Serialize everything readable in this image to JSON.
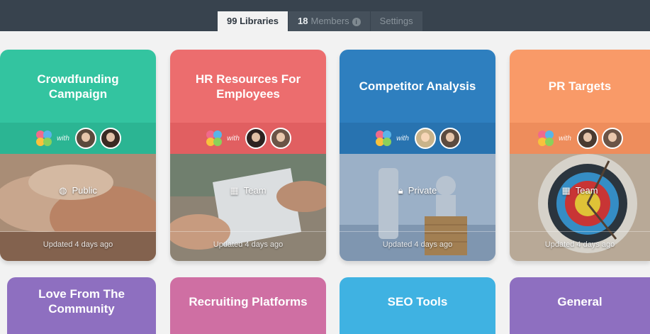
{
  "tabs": {
    "libraries_count": "99",
    "libraries_label": "Libraries",
    "members_count": "18",
    "members_label": "Members",
    "members_info_icon": "i",
    "settings_label": "Settings"
  },
  "colors": {
    "topbar": "#38434e",
    "green": "#33c4a0",
    "red": "#ec6d6e",
    "blue": "#2e7fbf",
    "orange": "#f99a68",
    "purple": "#8e6fc0",
    "pink": "#cf6fa3",
    "sky": "#3fb2e2"
  },
  "cards": [
    {
      "title": "Crowdfunding Campaign",
      "with": "with",
      "privacy_icon": "globe-icon",
      "privacy": "Public",
      "updated": "Updated 4 days ago"
    },
    {
      "title": "HR Resources For Employees",
      "with": "with",
      "privacy_icon": "building-icon",
      "privacy": "Team",
      "updated": "Updated 4 days ago"
    },
    {
      "title": "Competitor Analysis",
      "with": "with",
      "privacy_icon": "lock-icon",
      "privacy": "Private",
      "updated": "Updated 4 days ago"
    },
    {
      "title": "PR Targets",
      "with": "with",
      "privacy_icon": "building-icon",
      "privacy": "Team",
      "updated": "Updated 4 days ago"
    }
  ],
  "bottom_cards": [
    {
      "title": "Love From The Community"
    },
    {
      "title": "Recruiting Platforms"
    },
    {
      "title": "SEO Tools"
    },
    {
      "title": "General"
    }
  ]
}
